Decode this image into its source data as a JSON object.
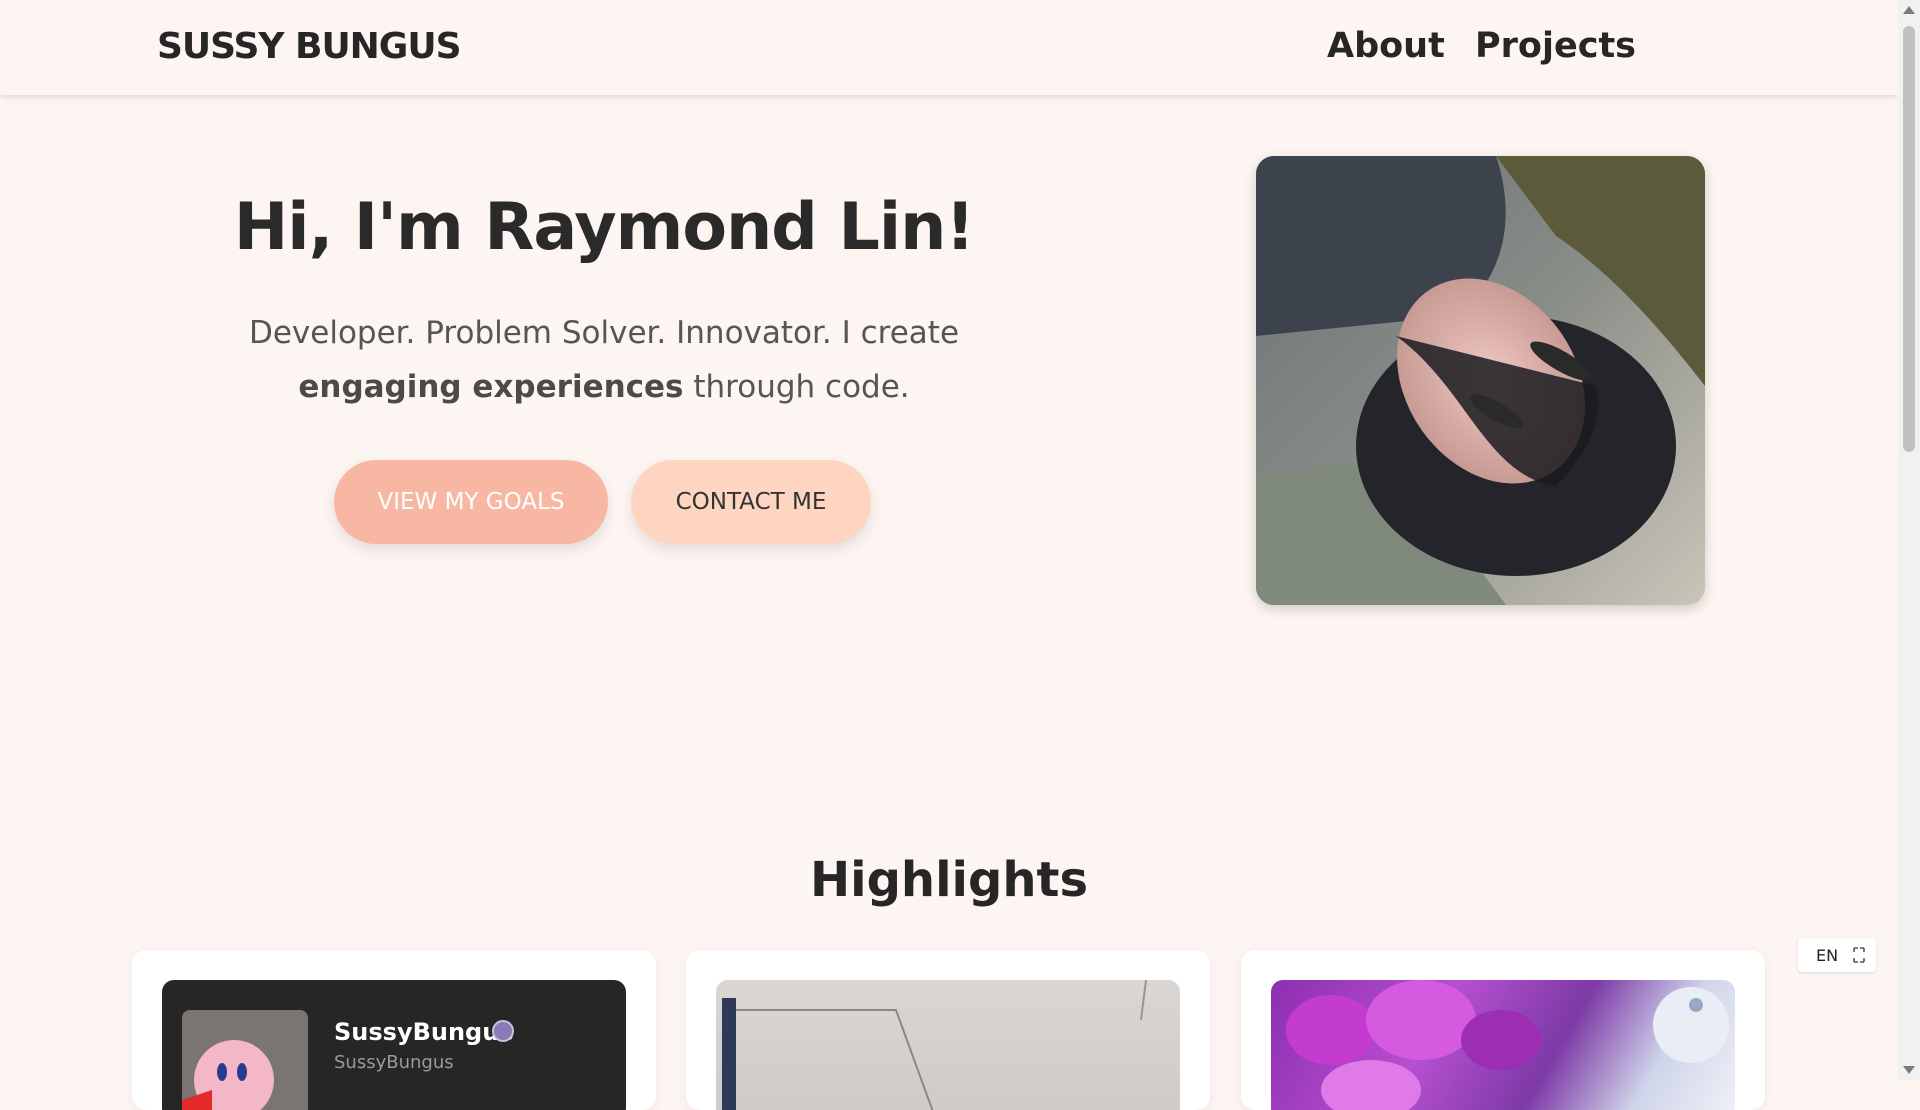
{
  "header": {
    "brand": "SUSSY BUNGUS",
    "nav": [
      "About",
      "Projects"
    ]
  },
  "hero": {
    "title": "Hi, I'm Raymond Lin!",
    "subtitle_part1": "Developer. Problem Solver. Innovator. I create ",
    "subtitle_bold": "engaging experiences",
    "subtitle_part2": " through code.",
    "buttons": {
      "goals": "VIEW MY GOALS",
      "contact": "CONTACT ME"
    }
  },
  "highlights": {
    "title": "Highlights",
    "cards": [
      {
        "profile_name": "SussyBungus",
        "profile_handle": "SussyBungus"
      }
    ]
  },
  "language_widget": {
    "label": "EN"
  },
  "colors": {
    "page_bg": "#fdf5f1",
    "button_primary": "#f8b7a3",
    "button_secondary": "#fdd5c0",
    "text_dark": "#262626"
  }
}
